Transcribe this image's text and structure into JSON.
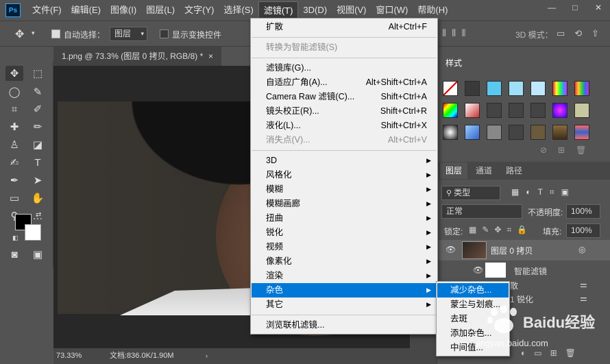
{
  "menubar": {
    "logo": "Ps",
    "items": [
      "文件(F)",
      "编辑(E)",
      "图像(I)",
      "图层(L)",
      "文字(Y)",
      "选择(S)",
      "滤镜(T)",
      "3D(D)",
      "视图(V)",
      "窗口(W)",
      "帮助(H)"
    ],
    "active_index": 6,
    "window_buttons": [
      "—",
      "□",
      "✕"
    ]
  },
  "options": {
    "auto_select_label": "自动选择：",
    "auto_select_value": "图层",
    "show_transform_label": "显示变换控件",
    "mode_3d_label": "3D 模式："
  },
  "document": {
    "tab_title": "1.png @ 73.3% (图层 0 拷贝, RGB/8) *",
    "tab_close": "×",
    "zoom": "73.33%",
    "doc_info": "文档:836.0K/1.90M"
  },
  "filter_menu": {
    "items": [
      {
        "label": "扩散",
        "shortcut": "Alt+Ctrl+F",
        "type": "normal"
      },
      {
        "type": "sep"
      },
      {
        "label": "转换为智能滤镜(S)",
        "shortcut": "",
        "type": "disabled"
      },
      {
        "type": "sep"
      },
      {
        "label": "滤镜库(G)...",
        "shortcut": "",
        "type": "normal"
      },
      {
        "label": "自适应广角(A)...",
        "shortcut": "Alt+Shift+Ctrl+A",
        "type": "normal"
      },
      {
        "label": "Camera Raw 滤镜(C)...",
        "shortcut": "Shift+Ctrl+A",
        "type": "normal"
      },
      {
        "label": "镜头校正(R)...",
        "shortcut": "Shift+Ctrl+R",
        "type": "normal"
      },
      {
        "label": "液化(L)...",
        "shortcut": "Shift+Ctrl+X",
        "type": "normal"
      },
      {
        "label": "消失点(V)...",
        "shortcut": "Alt+Ctrl+V",
        "type": "disabled"
      },
      {
        "type": "sep"
      },
      {
        "label": "3D",
        "type": "sub"
      },
      {
        "label": "风格化",
        "type": "sub"
      },
      {
        "label": "模糊",
        "type": "sub"
      },
      {
        "label": "模糊画廊",
        "type": "sub"
      },
      {
        "label": "扭曲",
        "type": "sub"
      },
      {
        "label": "锐化",
        "type": "sub"
      },
      {
        "label": "视频",
        "type": "sub"
      },
      {
        "label": "像素化",
        "type": "sub"
      },
      {
        "label": "渲染",
        "type": "sub"
      },
      {
        "label": "杂色",
        "type": "sub",
        "highlight": true
      },
      {
        "label": "其它",
        "type": "sub"
      },
      {
        "type": "sep"
      },
      {
        "label": "浏览联机滤镜...",
        "shortcut": "",
        "type": "normal"
      }
    ]
  },
  "noise_submenu": {
    "items": [
      "减少杂色...",
      "蒙尘与划痕...",
      "去斑",
      "添加杂色...",
      "中间值..."
    ],
    "highlight_index": 0
  },
  "styles_panel": {
    "tab": "样式"
  },
  "layers_panel": {
    "tabs": [
      "图层",
      "通道",
      "路径"
    ],
    "filter_kind": "类型",
    "blend_mode": "正常",
    "opacity_label": "不透明度:",
    "opacity_value": "100%",
    "lock_label": "锁定:",
    "fill_label": "填充:",
    "fill_value": "100%",
    "layer_name": "图层 0 拷贝",
    "smart_filter_label": "智能滤镜",
    "partial_row1": "散",
    "partial_row2": "1 锐化"
  },
  "watermark": {
    "brand": "Baidu经验",
    "url": "jingyan.baidu.com"
  },
  "colors": {
    "menu_highlight": "#0078d7",
    "ui_bg": "#535353",
    "menu_bg": "#f0f0f0"
  }
}
